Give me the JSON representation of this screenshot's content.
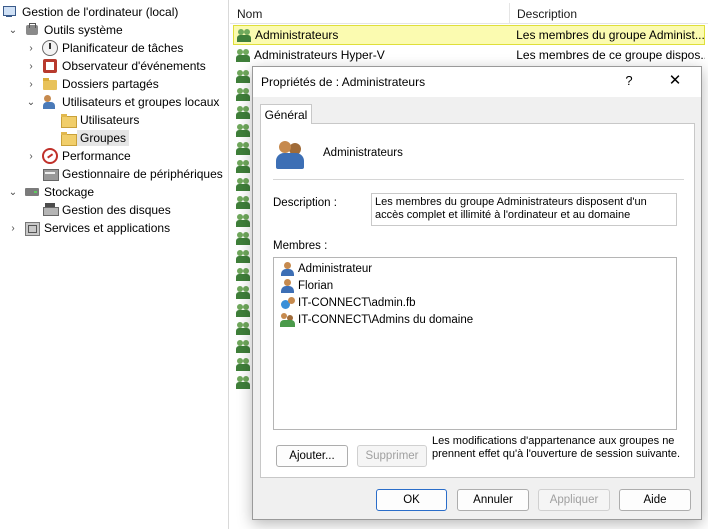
{
  "tree": {
    "root": "Gestion de l'ordinateur (local)",
    "system_tools": "Outils système",
    "task_scheduler": "Planificateur de tâches",
    "event_viewer": "Observateur d'événements",
    "shared_folders": "Dossiers partagés",
    "local_users": "Utilisateurs et groupes locaux",
    "users": "Utilisateurs",
    "groups": "Groupes",
    "performance": "Performance",
    "device_manager": "Gestionnaire de périphériques",
    "storage": "Stockage",
    "disk_management": "Gestion des disques",
    "services_apps": "Services et applications"
  },
  "list": {
    "col_name": "Nom",
    "col_desc": "Description",
    "rows": [
      {
        "name": "Administrateurs",
        "desc": "Les membres du groupe Administ..."
      },
      {
        "name": "Administrateurs Hyper-V",
        "desc": "Les membres de ce groupe dispos..."
      }
    ]
  },
  "dialog": {
    "title": "Propriétés de : Administrateurs",
    "help": "?",
    "close": "✕",
    "tab": "Général",
    "group_name": "Administrateurs",
    "desc_label": "Description :",
    "desc_value": "Les membres du groupe Administrateurs disposent d'un accès complet et illimité à l'ordinateur et au domaine",
    "members_label": "Membres :",
    "members": [
      {
        "name": "Administrateur",
        "icon": "user-icon"
      },
      {
        "name": "Florian",
        "icon": "user-icon"
      },
      {
        "name": "IT-CONNECT\\admin.fb",
        "icon": "domain-user-icon"
      },
      {
        "name": "IT-CONNECT\\Admins du domaine",
        "icon": "domain-group-icon"
      }
    ],
    "add": "Ajouter...",
    "remove": "Supprimer",
    "note": "Les modifications d'appartenance aux groupes ne prennent effet qu'à l'ouverture de session suivante.",
    "ok": "OK",
    "cancel": "Annuler",
    "apply": "Appliquer",
    "help_btn": "Aide"
  }
}
